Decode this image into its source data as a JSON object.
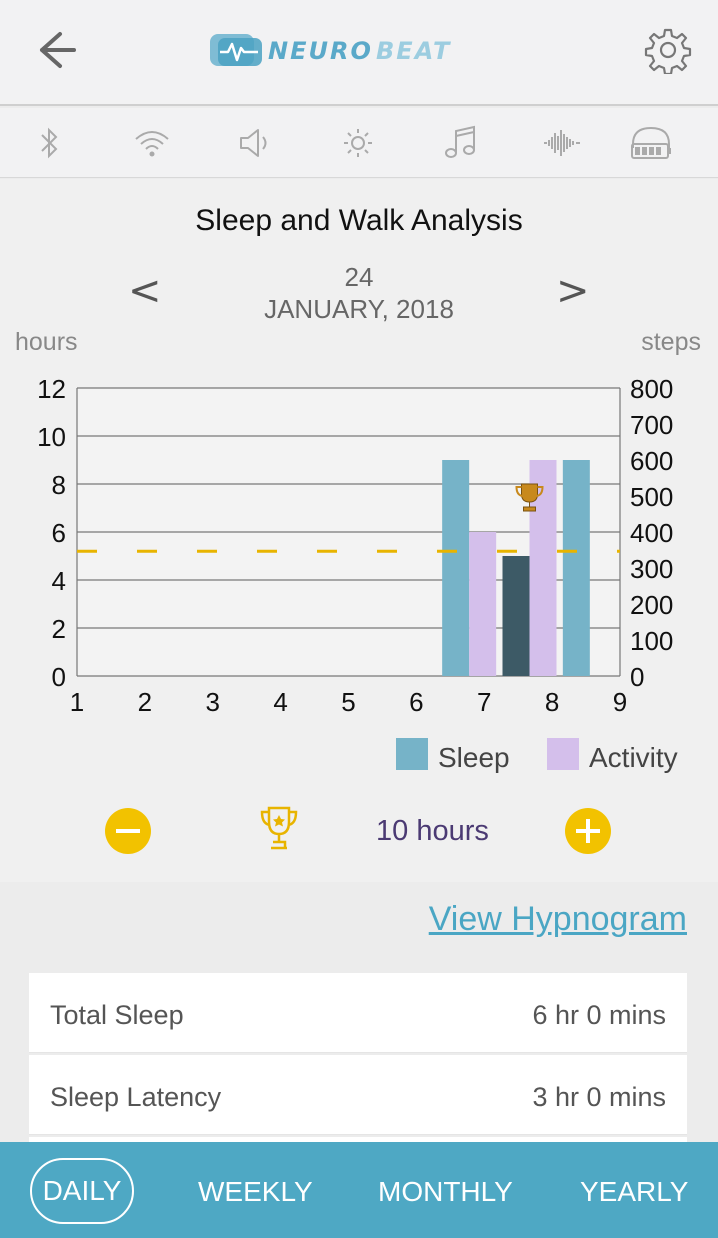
{
  "header": {
    "logo_text": "NEUROBEAT",
    "back_icon": "back-arrow-icon",
    "settings_icon": "gear-icon"
  },
  "icon_bar": [
    "bluetooth-icon",
    "wifi-icon",
    "speaker-icon",
    "brightness-icon",
    "music-icon",
    "sound-wave-icon",
    "headphones-battery-icon"
  ],
  "chart_title": "Sleep and Walk Analysis",
  "date": {
    "day": "24",
    "month_year": "JANUARY, 2018",
    "prev": "<",
    "next": ">"
  },
  "axes": {
    "left_label": "hours",
    "right_label": "steps"
  },
  "chart_data": {
    "type": "bar",
    "categories": [
      "1",
      "2",
      "3",
      "4",
      "5",
      "6",
      "7",
      "8",
      "9"
    ],
    "series": [
      {
        "name": "Sleep",
        "color": "#76b3c8",
        "values": [
          0,
          0,
          0,
          0,
          0,
          0,
          9,
          5,
          9
        ]
      },
      {
        "name": "Activity",
        "color": "#d4bfeb",
        "values": [
          0,
          0,
          0,
          0,
          0,
          0,
          400,
          600,
          null
        ],
        "axis": "right"
      }
    ],
    "highlight": {
      "category": "8",
      "series": "Sleep",
      "color": "#3d5a66"
    },
    "goal_line": {
      "value": 5.2,
      "color": "#e8b400",
      "style": "dashed"
    },
    "yleft": {
      "label": "hours",
      "ylim": [
        0,
        12
      ],
      "ticks": [
        0,
        2,
        4,
        6,
        8,
        10,
        12
      ]
    },
    "yright": {
      "label": "steps",
      "ylim": [
        0,
        800
      ],
      "ticks": [
        0,
        100,
        200,
        300,
        400,
        500,
        600,
        700,
        800
      ]
    },
    "trophy_marker": {
      "category": "8"
    },
    "legend": [
      "Sleep",
      "Activity"
    ],
    "grid": true
  },
  "legend": {
    "sleep": "Sleep",
    "activity": "Activity"
  },
  "goal": {
    "value_text": "10 hours",
    "minus_icon": "minus-icon",
    "plus_icon": "plus-icon",
    "trophy_icon": "trophy-icon"
  },
  "view_link": "View Hypnogram",
  "stats": [
    {
      "label": "Total Sleep",
      "value": "6 hr 0 mins"
    },
    {
      "label": "Sleep Latency",
      "value": "3 hr 0 mins"
    }
  ],
  "tabs": [
    "DAILY",
    "WEEKLY",
    "MONTHLY",
    "YEARLY"
  ],
  "active_tab": "DAILY"
}
